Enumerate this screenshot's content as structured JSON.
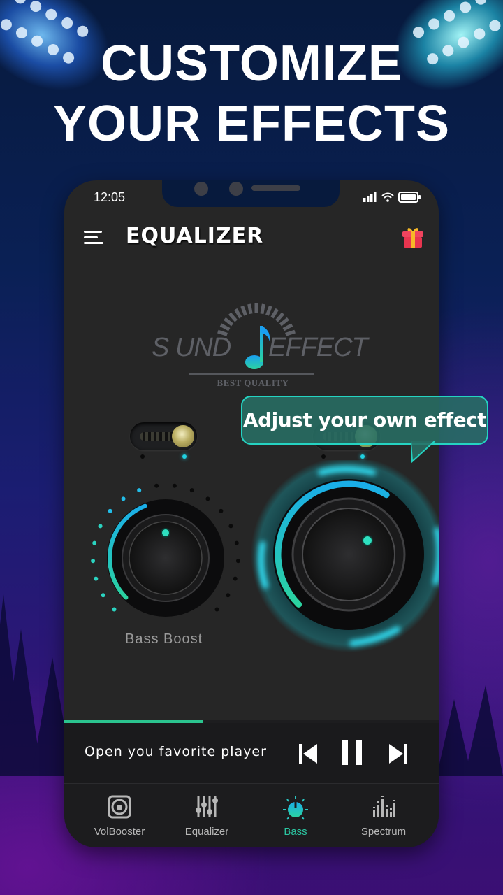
{
  "promo": {
    "headline_line1": "CUSTOMIZE",
    "headline_line2": "YOUR EFFECTS"
  },
  "status_bar": {
    "time": "12:05",
    "icons": [
      "signal-icon",
      "wifi-icon",
      "battery-icon"
    ]
  },
  "app_bar": {
    "title": "EQUALIZER",
    "left_icon": "menu-icon",
    "right_icon": "gift-icon"
  },
  "logo": {
    "word_left": "S  UND",
    "word_right": "EFFECT",
    "subtitle": "BEST QUALITY"
  },
  "controls": {
    "bass_boost": {
      "label": "Bass Boost",
      "enabled": true,
      "level_fraction": 0.42
    },
    "virtualizer": {
      "label": "",
      "enabled": true,
      "level_fraction": 0.62
    }
  },
  "tooltip": {
    "text": "Adjust your own effect"
  },
  "player": {
    "progress_fraction": 0.37,
    "text": "Open you favorite player",
    "buttons": [
      "previous",
      "pause",
      "next"
    ]
  },
  "bottom_nav": {
    "active_index": 2,
    "items": [
      {
        "label": "VolBooster",
        "icon": "speaker-icon"
      },
      {
        "label": "Equalizer",
        "icon": "sliders-icon"
      },
      {
        "label": "Bass",
        "icon": "bass-knob-icon"
      },
      {
        "label": "Spectrum",
        "icon": "spectrum-icon"
      }
    ]
  },
  "colors": {
    "accent_teal": "#2bc4a0",
    "accent_blue": "#1ab5e8",
    "phone_bg": "#262626"
  }
}
